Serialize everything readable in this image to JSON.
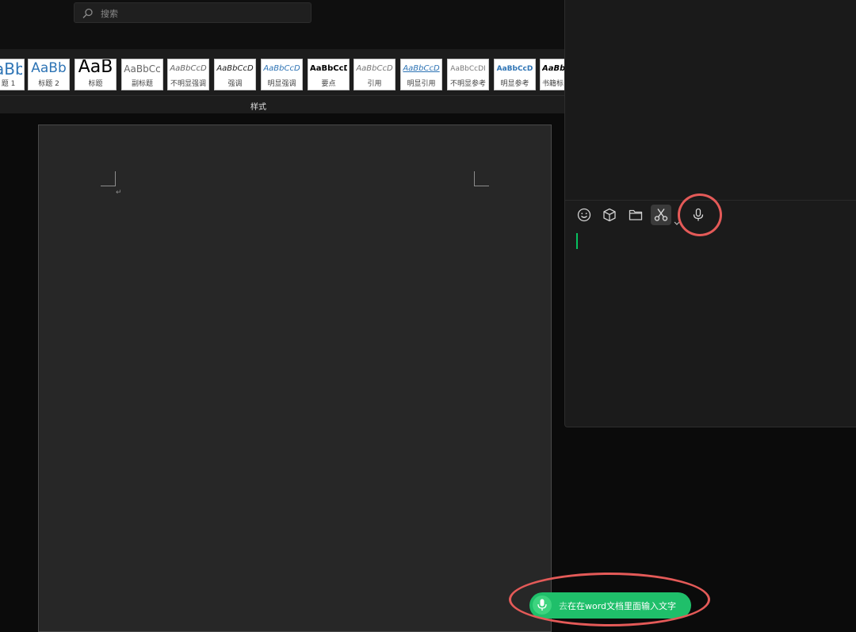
{
  "word": {
    "search": {
      "placeholder": "搜索"
    },
    "styles_group_label": "样式",
    "styles": [
      {
        "preview": "aBb",
        "name": "题 1"
      },
      {
        "preview": "AaBb",
        "name": "标题 2"
      },
      {
        "preview": "AaB",
        "name": "标题"
      },
      {
        "preview": "AaBbCc",
        "name": "副标题"
      },
      {
        "preview": "AaBbCcD",
        "name": "不明显强调"
      },
      {
        "preview": "AaBbCcD",
        "name": "强调"
      },
      {
        "preview": "AaBbCcD",
        "name": "明显强调"
      },
      {
        "preview": "AaBbCcD",
        "name": "要点"
      },
      {
        "preview": "AaBbCcD",
        "name": "引用"
      },
      {
        "preview": "AaBbCcD",
        "name": "明显引用"
      },
      {
        "preview": "AaBbCcDI",
        "name": "不明显参考"
      },
      {
        "preview": "AaBbCcD",
        "name": "明显参考"
      },
      {
        "preview": "AaBb",
        "name": "书籍标"
      }
    ],
    "document": {
      "paragraph_mark": "↵"
    }
  },
  "chat": {
    "toolbar": {
      "emoji": "emoji-icon",
      "box": "3d-box-icon",
      "folder": "folder-icon",
      "scissors": "scissors-icon",
      "mic": "microphone-icon"
    }
  },
  "voice_input": {
    "text_dim": "去",
    "text": "在在word文档里面输入文字"
  },
  "colors": {
    "accent_green": "#07c160",
    "annotation_red": "#e45a58"
  }
}
